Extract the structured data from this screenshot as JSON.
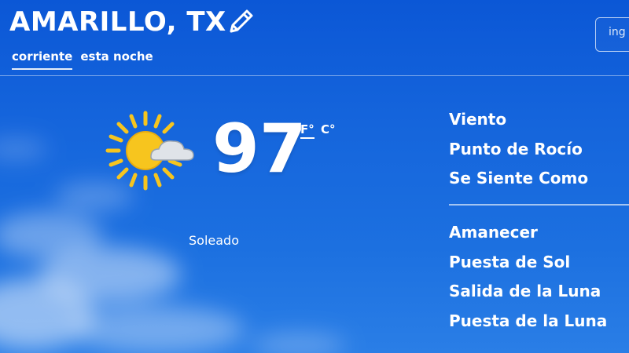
{
  "header": {
    "city": "AMARILLO, TX",
    "tabs": [
      "corriente",
      "esta noche"
    ],
    "search_text": "ing"
  },
  "current": {
    "temperature": "97",
    "unit_f": "F°",
    "unit_c": "C°",
    "condition": "Soleado",
    "icon": "partly-sunny-icon"
  },
  "details": {
    "group1": [
      "Viento",
      "Punto de Rocío",
      "Se Siente Como"
    ],
    "group2": [
      "Amanecer",
      "Puesta de Sol",
      "Salida de la Luna",
      "Puesta de la Luna"
    ]
  }
}
